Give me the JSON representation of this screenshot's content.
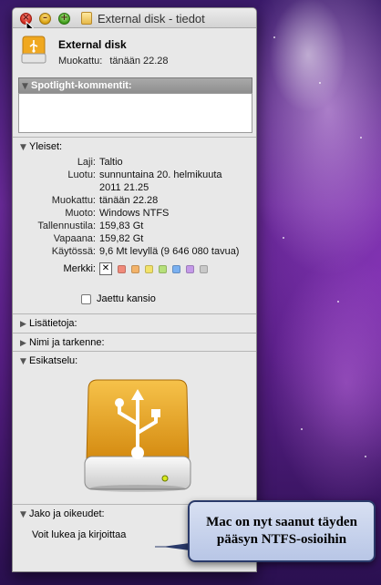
{
  "window": {
    "title": "External disk - tiedot",
    "title_icon": "disk-icon"
  },
  "header": {
    "name": "External disk",
    "modified_label": "Muokattu:",
    "modified_value": "tänään 22.28"
  },
  "spotlight": {
    "label": "Spotlight-kommentit:",
    "comment": ""
  },
  "general": {
    "label": "Yleiset:",
    "rows": [
      {
        "k": "Laji:",
        "v": "Taltio"
      },
      {
        "k": "Luotu:",
        "v": "sunnuntaina 20. helmikuuta 2011 21.25"
      },
      {
        "k": "Muokattu:",
        "v": "tänään 22.28"
      },
      {
        "k": "Muoto:",
        "v": "Windows NTFS"
      },
      {
        "k": "Tallennustila:",
        "v": "159,83 Gt"
      },
      {
        "k": "Vapaana:",
        "v": "159,82 Gt"
      },
      {
        "k": "Käytössä:",
        "v": "9,6 Mt levyllä (9 646 080 tavua)"
      }
    ],
    "labels_key": "Merkki:",
    "label_colors": [
      "#f08a7a",
      "#f3b36a",
      "#f2e26a",
      "#b6e07a",
      "#7ab0f0",
      "#c49ae8",
      "#c8c8c8"
    ],
    "shared_folder": "Jaettu kansio"
  },
  "sections": {
    "more_info": "Lisätietoja:",
    "name_ext": "Nimi ja tarkenne:",
    "preview": "Esikatselu:",
    "sharing": "Jako ja oikeudet:"
  },
  "permissions": {
    "text": "Voit lukea ja kirjoittaa"
  },
  "callout": {
    "line1": "Mac on nyt saanut täyden",
    "line2": "pääsyn NTFS-osioihin"
  },
  "colors": {
    "drive_orange": "#f0a820",
    "callout_border": "#2a3a6a"
  }
}
